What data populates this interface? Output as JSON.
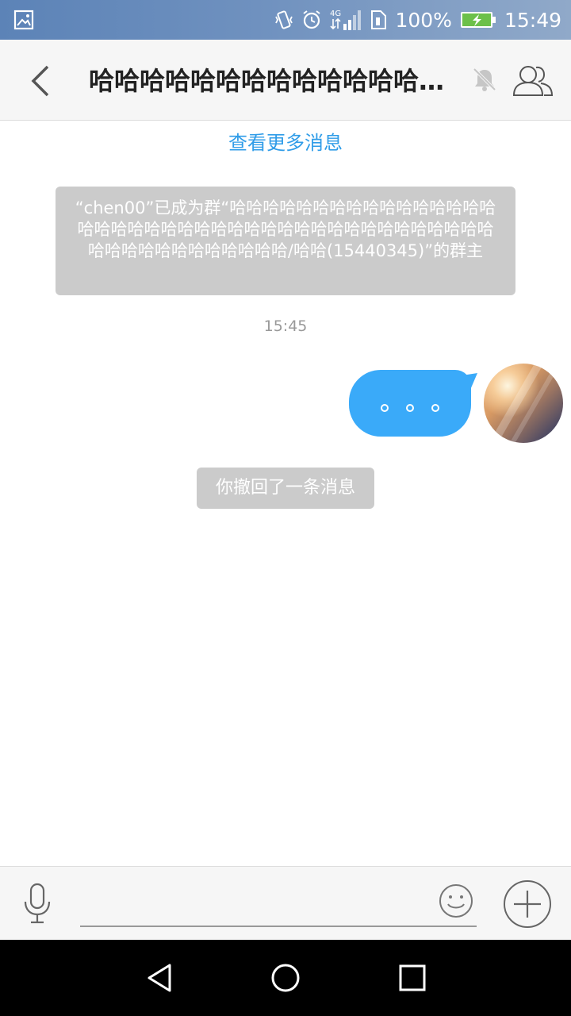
{
  "status_bar": {
    "battery": "100%",
    "time": "15:49",
    "network": "4G"
  },
  "header": {
    "title": "哈哈哈哈哈哈哈哈哈哈哈哈哈哈哈哈哈哈哈哈哈哈哈哈哈哈哈哈哈哈哈哈哈哈哈哈哈哈哈哈哈哈哈哈哈哈哈哈哈哈哈哈哈/哈哈"
  },
  "chat": {
    "load_more": "查看更多消息",
    "system_notice": "“chen00”已成为群“哈哈哈哈哈哈哈哈哈哈哈哈哈哈哈哈哈哈哈哈哈哈哈哈哈哈哈哈哈哈哈哈哈哈哈哈哈哈哈哈哈哈哈哈哈哈哈哈哈哈哈哈哈/哈哈(15440345)”的群主",
    "timestamp": "15:45",
    "recall_notice": "你撤回了一条消息"
  },
  "colors": {
    "accent": "#2f9ce8",
    "bubble": "#3aaaf9",
    "notice_bg": "#cbcbcb"
  },
  "icons": {
    "status_left": "image-icon",
    "vibrate": "vibrate-icon",
    "alarm": "alarm-icon",
    "signal": "signal-icon",
    "sim": "sim-icon",
    "battery": "battery-charging-icon",
    "back": "chevron-left-icon",
    "mute": "bell-off-icon",
    "group": "group-members-icon",
    "mic": "microphone-icon",
    "emoji": "smiley-icon",
    "plus": "plus-circle-icon"
  }
}
